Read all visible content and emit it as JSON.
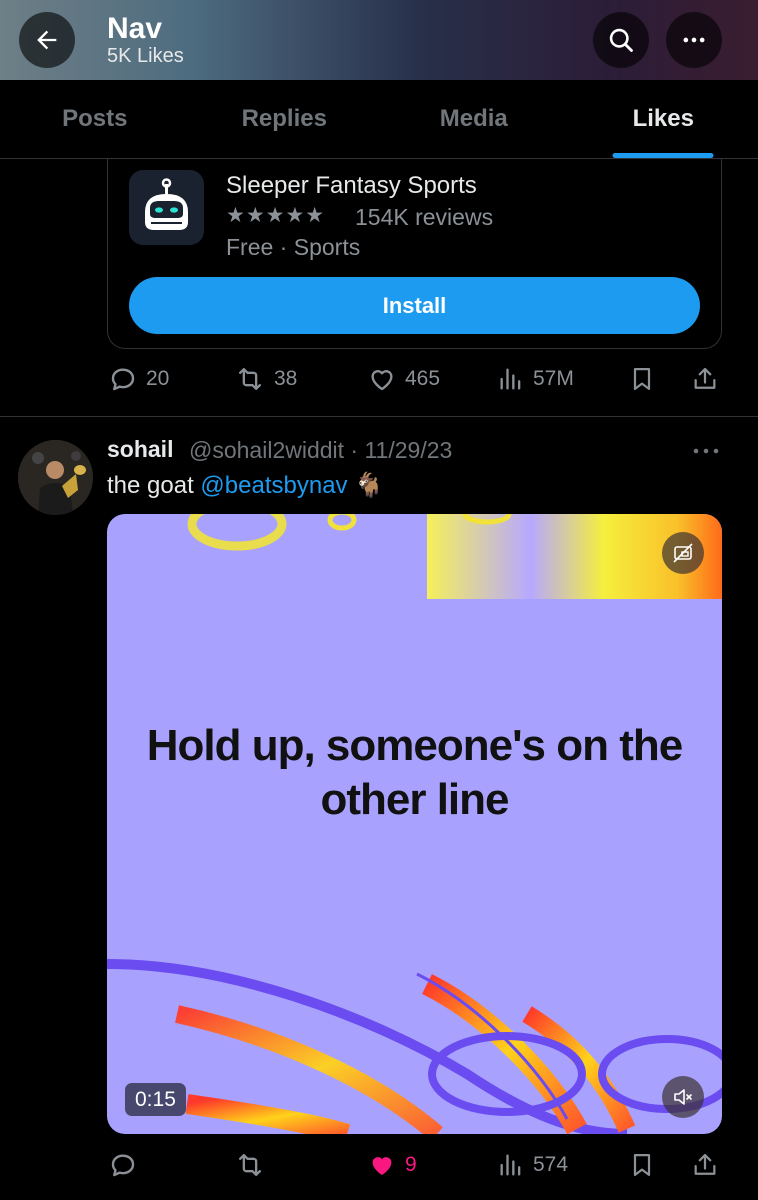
{
  "header": {
    "title": "Nav",
    "subtitle": "5K Likes"
  },
  "tabs": [
    {
      "label": "Posts"
    },
    {
      "label": "Replies"
    },
    {
      "label": "Media"
    },
    {
      "label": "Likes"
    }
  ],
  "ad": {
    "app_name": "Sleeper Fantasy Sports",
    "stars": "★★★★★",
    "reviews": "154K reviews",
    "meta": "Free · Sports",
    "install_label": "Install"
  },
  "post1_actions": {
    "replies": "20",
    "reposts": "38",
    "likes": "465",
    "views": "57M"
  },
  "tweet": {
    "name": "sohail",
    "meta": "@sohail2widdit · 11/29/23",
    "text": "the goat ",
    "mention": "@beatsbynav",
    "emoji": "🐐",
    "media_text": "Hold up, someone's on the other line",
    "video_time": "0:15",
    "actions": {
      "reposts": "",
      "likes": "9",
      "views": "574"
    }
  },
  "colors": {
    "accent": "#1d9bf0",
    "like_active": "#f91880",
    "media_bg": "#a8a2fe"
  }
}
